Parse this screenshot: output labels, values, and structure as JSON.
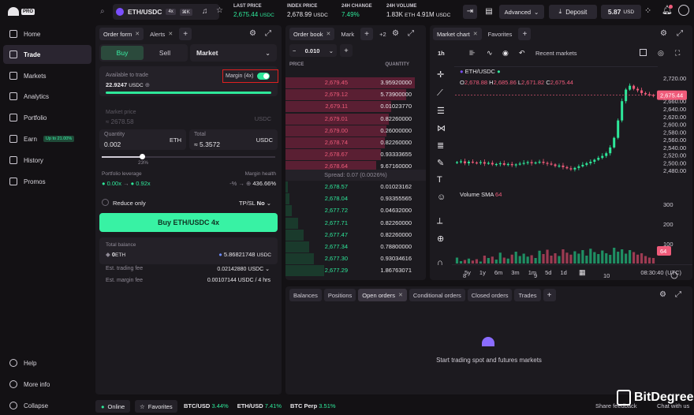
{
  "brand": {
    "name": "kraken",
    "badge": "PRO"
  },
  "nav": [
    {
      "label": "Home",
      "icon": "home-icon"
    },
    {
      "label": "Trade",
      "icon": "trade-icon",
      "active": true
    },
    {
      "label": "Markets",
      "icon": "markets-icon"
    },
    {
      "label": "Analytics",
      "icon": "analytics-icon"
    },
    {
      "label": "Portfolio",
      "icon": "portfolio-icon"
    },
    {
      "label": "Earn",
      "icon": "earn-icon",
      "badge": "Up to 21.00%"
    },
    {
      "label": "History",
      "icon": "history-icon"
    },
    {
      "label": "Promos",
      "icon": "promos-icon"
    }
  ],
  "nav_bottom": [
    {
      "label": "Help"
    },
    {
      "label": "More info"
    },
    {
      "label": "Collapse"
    }
  ],
  "topbar": {
    "pair": "ETH/USDC",
    "leverage": "4x",
    "shortcut": "⌘K",
    "last_price_label": "LAST PRICE",
    "last_price": "2,675.44",
    "last_price_unit": "USDC",
    "index_label": "INDEX PRICE",
    "index": "2,678.99",
    "index_unit": "USDC",
    "change_label": "24H CHANGE",
    "change": "7.49%",
    "volume_label": "24H VOLUME",
    "volume_base": "1.83K",
    "volume_base_unit": "ETH",
    "volume_quote": "4.91M",
    "volume_quote_unit": "USDC",
    "advanced": "Advanced",
    "deposit": "Deposit",
    "balance": "5.87",
    "balance_unit": "USD"
  },
  "order_form": {
    "tabs": [
      "Order form",
      "Alerts"
    ],
    "buy": "Buy",
    "sell": "Sell",
    "order_type": "Market",
    "available_label": "Available to trade",
    "available_value": "22.9247",
    "available_unit": "USDC",
    "margin_label": "Margin (4x)",
    "market_price_label": "Market price",
    "market_price": "2678.58",
    "market_price_unit": "USDC",
    "quantity_label": "Quantity",
    "quantity": "0.002",
    "quantity_unit": "ETH",
    "total_label": "Total",
    "total": "5.3572",
    "total_unit": "USDC",
    "slider_pct": "23%",
    "leverage_label": "Portfolio leverage",
    "leverage_from": "0.00x",
    "leverage_to": "0.92x",
    "health_label": "Margin health",
    "health_from": "-%",
    "health_to": "436.66%",
    "reduce_only": "Reduce only",
    "tpsl_label": "TP/SL",
    "tpsl_value": "No",
    "submit": "Buy ETH/USDC 4x",
    "total_balance_label": "Total balance",
    "total_balance_eth": "0",
    "total_balance_eth_unit": "ETH",
    "total_balance_usdc": "5.86821748",
    "total_balance_usdc_unit": "USDC",
    "fee_label": "Est. trading fee",
    "fee_value": "0.02142880 USDC",
    "margin_fee_label": "Est. margin fee",
    "margin_fee_value": "0.00107144 USDC / 4 hrs",
    "slider_fraction": 0.23
  },
  "order_book": {
    "tabs": [
      "Order book",
      "Mark"
    ],
    "more": "+2",
    "step": "0.010",
    "price_header": "PRICE",
    "qty_header": "QUANTITY",
    "asks": [
      {
        "price": "2,679.45",
        "qty": "3.95920000",
        "depth": 1.0
      },
      {
        "price": "2,679.12",
        "qty": "5.73900000",
        "depth": 0.93
      },
      {
        "price": "2,679.11",
        "qty": "0.01023770",
        "depth": 0.82
      },
      {
        "price": "2,679.01",
        "qty": "0.82260000",
        "depth": 0.8
      },
      {
        "price": "2,679.00",
        "qty": "0.26000000",
        "depth": 0.78
      },
      {
        "price": "2,678.74",
        "qty": "0.82260000",
        "depth": 0.77
      },
      {
        "price": "2,678.67",
        "qty": "0.93333655",
        "depth": 0.74
      },
      {
        "price": "2,678.64",
        "qty": "9.67160000",
        "depth": 0.7
      }
    ],
    "spread": "Spread: 0.07 (0.0026%)",
    "bids": [
      {
        "price": "2,678.57",
        "qty": "0.01023162",
        "depth": 0.02
      },
      {
        "price": "2,678.04",
        "qty": "0.93355565",
        "depth": 0.03
      },
      {
        "price": "2,677.72",
        "qty": "0.04632000",
        "depth": 0.05
      },
      {
        "price": "2,677.71",
        "qty": "0.82260000",
        "depth": 0.1
      },
      {
        "price": "2,677.47",
        "qty": "0.82260000",
        "depth": 0.14
      },
      {
        "price": "2,677.34",
        "qty": "0.78800000",
        "depth": 0.18
      },
      {
        "price": "2,677.30",
        "qty": "0.93034616",
        "depth": 0.22
      },
      {
        "price": "2,677.29",
        "qty": "1.86763071",
        "depth": 0.3
      }
    ]
  },
  "chart": {
    "tabs": [
      "Market chart",
      "Favorites"
    ],
    "interval": "1h",
    "recent": "Recent markets",
    "symbol": "ETH/USDC",
    "ohlc": {
      "o": "2,678.88",
      "h": "2,685.86",
      "l": "2,671.82",
      "c": "2,675.44"
    },
    "volume_label": "Volume SMA",
    "volume_value": "64",
    "last_price_tag": "2,675.44",
    "volume_tag": "64",
    "time_labels": [
      "8",
      "9",
      "10"
    ],
    "ranges": [
      "5y",
      "1y",
      "6m",
      "3m",
      "1m",
      "5d",
      "1d"
    ],
    "clock": "08:30:40 (UTC)"
  },
  "chart_data": {
    "type": "candlestick",
    "ylim": [
      2460,
      2730
    ],
    "y_ticks": [
      "2,720.00",
      "2,660.00",
      "2,640.00",
      "2,620.00",
      "2,600.00",
      "2,580.00",
      "2,560.00",
      "2,540.00",
      "2,520.00",
      "2,500.00",
      "2,480.00"
    ],
    "x_ticks": [
      "8",
      "9",
      "10"
    ],
    "close": [
      2502,
      2504,
      2499,
      2503,
      2501,
      2500,
      2502,
      2498,
      2500,
      2496,
      2497,
      2499,
      2495,
      2497,
      2494,
      2496,
      2498,
      2500,
      2502,
      2499,
      2501,
      2503,
      2500,
      2498,
      2496,
      2492,
      2493,
      2489,
      2486,
      2483,
      2487,
      2491,
      2495,
      2499,
      2503,
      2508,
      2513,
      2518,
      2525,
      2540,
      2565,
      2610,
      2660,
      2690,
      2700,
      2692,
      2688,
      2681,
      2678,
      2676,
      2675
    ]
  },
  "volume_data": {
    "values": [
      30,
      12,
      18,
      25,
      15,
      22,
      10,
      40,
      28,
      35,
      20,
      55,
      30,
      25,
      45,
      60,
      38,
      50,
      35,
      42,
      28,
      65,
      48,
      70,
      40,
      52,
      38,
      72,
      55,
      45,
      62,
      50,
      68,
      40,
      75,
      58,
      48,
      66,
      52,
      44,
      80,
      60,
      72,
      50,
      68,
      58,
      45,
      52,
      38,
      30,
      28
    ],
    "y_ticks": [
      "300",
      "200",
      "100"
    ]
  },
  "bottom_panel": {
    "tabs": [
      "Balances",
      "Positions",
      "Open orders",
      "Conditional orders",
      "Closed orders",
      "Trades"
    ],
    "active": "Open orders",
    "empty": "Start trading spot and futures markets"
  },
  "status": {
    "online": "Online",
    "favorites": "Favorites",
    "tickers": [
      {
        "sym": "BTC/USD",
        "chg": "3.44%"
      },
      {
        "sym": "ETH/USD",
        "chg": "7.41%"
      },
      {
        "sym": "BTC Perp",
        "chg": "3.51%"
      }
    ],
    "share": "Share feedback",
    "chat": "Chat with us"
  },
  "watermark": "BitDegree",
  "colors": {
    "green": "#2ee89a",
    "red": "#ef5b7a",
    "accent": "#7b4fff",
    "buy": "#38f2a4"
  }
}
